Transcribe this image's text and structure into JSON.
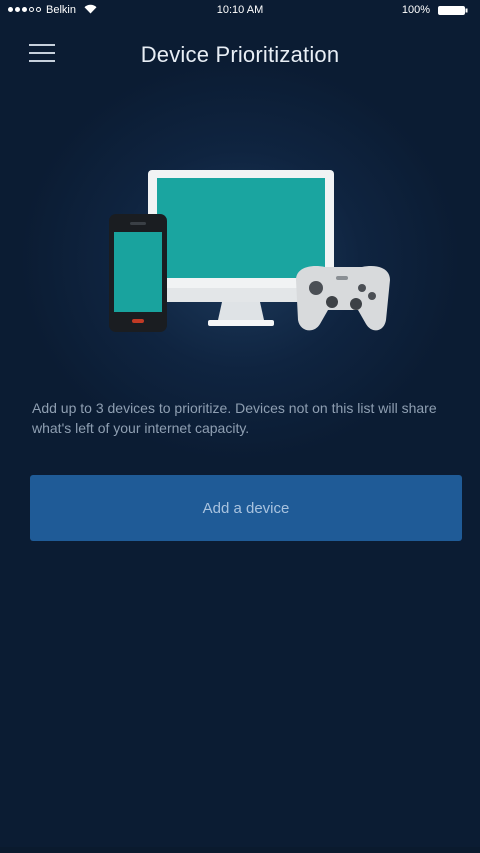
{
  "status_bar": {
    "carrier": "Belkin",
    "time": "10:10 AM",
    "battery": "100%"
  },
  "header": {
    "title": "Device Prioritization",
    "menu_icon": "hamburger-menu-icon"
  },
  "main": {
    "illustration_icons": [
      "smartphone-icon",
      "monitor-icon",
      "game-controller-icon"
    ],
    "description": "Add up to 3 devices to prioritize. Devices not on this list will share what's left of your internet capacity.",
    "add_device_label": "Add a device"
  },
  "colors": {
    "background": "#0b1c33",
    "button": "#1f5b97",
    "button_text": "#a9c3df",
    "description_text": "#8f9fb2"
  }
}
